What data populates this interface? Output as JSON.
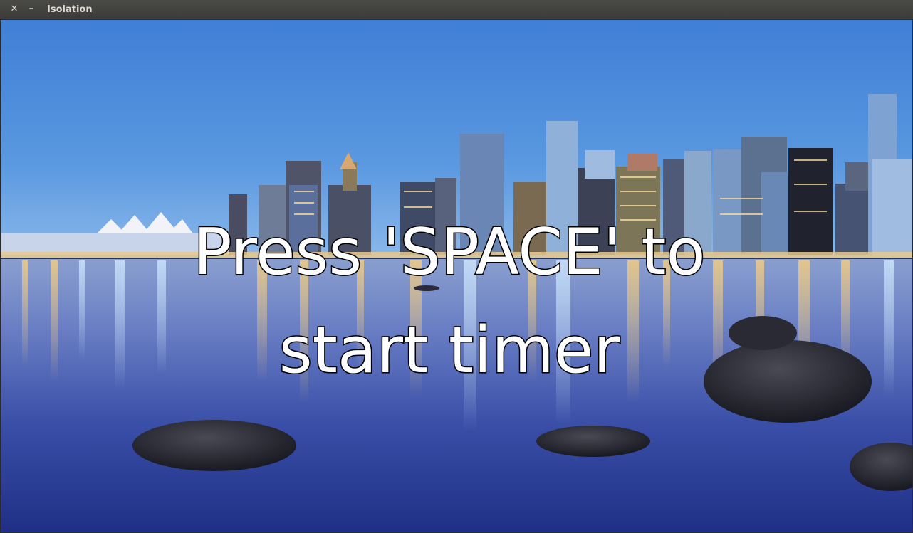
{
  "window": {
    "title": "Isolation",
    "close_glyph": "✕",
    "minimize_glyph": "–"
  },
  "background": {
    "icon": "city-waterfront-night-photo"
  },
  "prompt": {
    "line1": "Press 'SPACE' to",
    "line2": "start timer"
  }
}
